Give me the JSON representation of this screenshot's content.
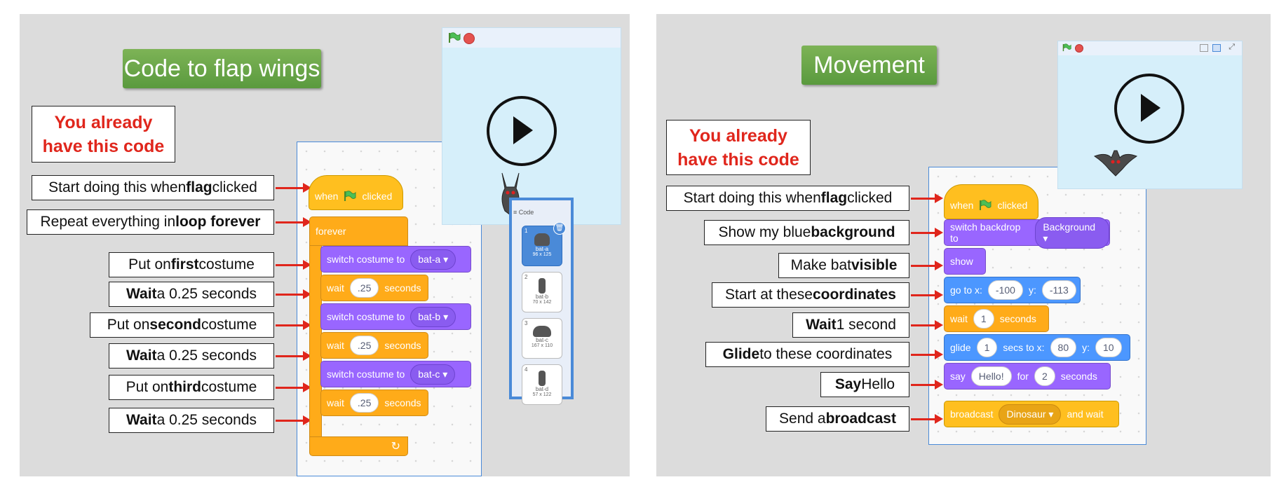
{
  "left": {
    "title": "Code to flap wings",
    "already": "You already have this code",
    "labels": [
      {
        "pre": "Start doing this when ",
        "bold": "flag",
        "post": " clicked"
      },
      {
        "pre": "Repeat everything in ",
        "bold": "loop forever",
        "post": ""
      },
      {
        "pre": "Put on ",
        "bold": "first",
        "post": " costume"
      },
      {
        "pre": "",
        "bold": "Wait",
        "post": " a 0.25 seconds"
      },
      {
        "pre": "Put on ",
        "bold": "second",
        "post": " costume"
      },
      {
        "pre": "",
        "bold": "Wait",
        "post": " a 0.25 seconds"
      },
      {
        "pre": "Put on ",
        "bold": "third",
        "post": " costume"
      },
      {
        "pre": "",
        "bold": "Wait",
        "post": " a 0.25 seconds"
      }
    ],
    "blocks": {
      "when": "when",
      "clicked": "clicked",
      "forever": "forever",
      "switch_costume": "switch costume to",
      "costume_a": "bat-a ▾",
      "costume_b": "bat-b ▾",
      "costume_c": "bat-c ▾",
      "wait": "wait",
      "wait_value": ".25",
      "seconds": "seconds"
    },
    "costume_panel": {
      "tab_code": "Code",
      "costumes": [
        {
          "num": "1",
          "name": "bat-a",
          "size": "96 x 125"
        },
        {
          "num": "2",
          "name": "bat-b",
          "size": "70 x 142"
        },
        {
          "num": "3",
          "name": "bat-c",
          "size": "167 x 110"
        },
        {
          "num": "4",
          "name": "bat-d",
          "size": "57 x 122"
        }
      ]
    }
  },
  "right": {
    "title": "Movement",
    "already": "You already have this code",
    "labels": [
      {
        "pre": "Start doing this when ",
        "bold": "flag",
        "post": " clicked"
      },
      {
        "pre": "Show my blue ",
        "bold": "background",
        "post": ""
      },
      {
        "pre": "Make bat ",
        "bold": "visible",
        "post": ""
      },
      {
        "pre": "Start at these ",
        "bold": "coordinates",
        "post": ""
      },
      {
        "pre": "",
        "bold": "Wait",
        "post": " 1 second"
      },
      {
        "pre": "",
        "bold": "Glide",
        "post": " to these coordinates"
      },
      {
        "pre": "",
        "bold": "Say",
        "post": " Hello"
      },
      {
        "pre": "Send a ",
        "bold": "broadcast",
        "post": ""
      }
    ],
    "blocks": {
      "when": "when",
      "clicked": "clicked",
      "switch_backdrop": "switch backdrop to",
      "backdrop": "Background ▾",
      "show": "show",
      "goto_x": "go to x:",
      "x_val": "-100",
      "y_lbl": "y:",
      "y_val": "-113",
      "wait": "wait",
      "wait_val": "1",
      "seconds": "seconds",
      "glide": "glide",
      "glide_secs": "1",
      "secs_to_x": "secs to x:",
      "glide_x": "80",
      "glide_y": "10",
      "say": "say",
      "say_val": "Hello!",
      "for": "for",
      "say_secs": "2",
      "say_seconds": "seconds",
      "broadcast": "broadcast",
      "broadcast_val": "Dinosaur ▾",
      "and_wait": "and wait"
    }
  },
  "colors": {
    "arrow": "#e0261c",
    "title_green": "#6aa84f",
    "stage": "#d6effa"
  }
}
